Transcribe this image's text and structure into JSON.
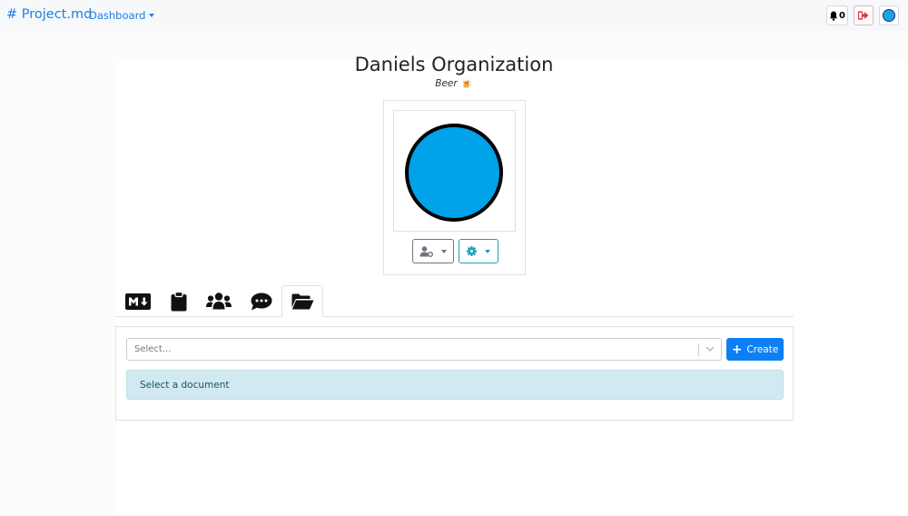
{
  "navbar": {
    "brand": "# Project.md",
    "dashboard_label": "Dashboard",
    "notification_count": "0"
  },
  "organization": {
    "name": "Daniels Organization",
    "subtitle": "Beer",
    "subtitle_emoji": "🍺",
    "avatar_color": "#00a2e8"
  },
  "tabs": [
    {
      "icon": "markdown-icon",
      "active": false
    },
    {
      "icon": "clipboard-icon",
      "active": false
    },
    {
      "icon": "users-icon",
      "active": false
    },
    {
      "icon": "comment-icon",
      "active": false
    },
    {
      "icon": "folder-open-icon",
      "active": true
    }
  ],
  "documents": {
    "select_placeholder": "Select...",
    "create_label": "Create",
    "alert_text": "Select a document"
  },
  "colors": {
    "primary": "#0d7ff5",
    "link": "#1b7fe8",
    "info": "#17a2b8",
    "danger": "#dc3545"
  }
}
